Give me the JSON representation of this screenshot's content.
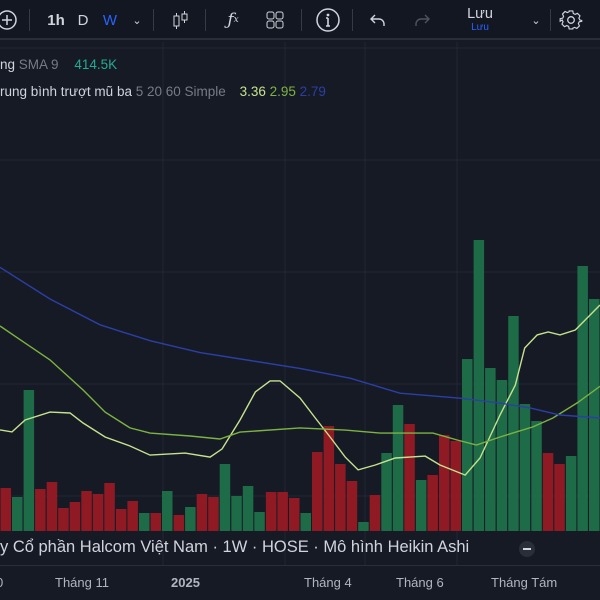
{
  "toolbar": {
    "intervals": [
      "1h",
      "D",
      "W"
    ],
    "active_interval": "W",
    "save_label": "Lưu",
    "save_sublabel": "Lưu"
  },
  "legend": {
    "volume_label": "ng",
    "volume_ma": "SMA 9",
    "volume_value": "414.5K",
    "ema_label": "rung bình trượt mũ ba",
    "ema_params": "5 20 60 Simple",
    "ema_values": [
      "3.36",
      "2.95",
      "2.79"
    ]
  },
  "title": "y Cổ phần Halcom Việt Nam · 1W · HOSE · Mô hình Heikin Ashi",
  "time_axis": [
    "0",
    "Tháng 11",
    "2025",
    "Tháng 4",
    "Tháng 6",
    "Tháng Tám"
  ],
  "colors": {
    "up": "#1e6b48",
    "down": "#8f1a24",
    "ma_fast": "#c7e28f",
    "ma_mid": "#7cb342",
    "ma_slow": "#2b3fa6",
    "accent": "#2962ff"
  },
  "chart_data": {
    "type": "bar",
    "title": "Volume (K) with moving averages",
    "volume_units": "K",
    "volumes": [
      215,
      170,
      705,
      210,
      245,
      115,
      145,
      200,
      185,
      240,
      110,
      150,
      90,
      90,
      200,
      80,
      120,
      185,
      170,
      335,
      175,
      225,
      95,
      195,
      195,
      165,
      90,
      395,
      525,
      335,
      250,
      45,
      180,
      390,
      630,
      535,
      255,
      280,
      480,
      450,
      860,
      1455,
      815,
      755,
      1075,
      635,
      550,
      390,
      335,
      375,
      1325,
      1160
    ],
    "directions": [
      "down",
      "up",
      "up",
      "down",
      "down",
      "down",
      "down",
      "down",
      "down",
      "down",
      "down",
      "down",
      "up",
      "down",
      "up",
      "down",
      "up",
      "down",
      "down",
      "up",
      "up",
      "up",
      "up",
      "down",
      "down",
      "down",
      "up",
      "down",
      "down",
      "down",
      "down",
      "up",
      "down",
      "up",
      "up",
      "down",
      "up",
      "down",
      "down",
      "down",
      "up",
      "up",
      "up",
      "up",
      "up",
      "up",
      "up",
      "down",
      "down",
      "up",
      "up",
      "up"
    ],
    "lines": [
      {
        "name": "MA 5",
        "color": "ma_fast",
        "points": [
          [
            0,
            2.73
          ],
          [
            1.02,
            2.72
          ],
          [
            2.13,
            2.78
          ],
          [
            4.25,
            2.82
          ],
          [
            5.95,
            2.815
          ],
          [
            7.06,
            2.765
          ],
          [
            8.93,
            2.694
          ],
          [
            11.05,
            2.649
          ],
          [
            12.75,
            2.603
          ],
          [
            15.73,
            2.613
          ],
          [
            17.86,
            2.593
          ],
          [
            18.88,
            2.634
          ],
          [
            20.4,
            2.78
          ],
          [
            21.7,
            2.921
          ],
          [
            22.96,
            2.977
          ],
          [
            23.8,
            2.977
          ],
          [
            25.5,
            2.891
          ],
          [
            26.8,
            2.79
          ],
          [
            28.06,
            2.694
          ],
          [
            29.34,
            2.593
          ],
          [
            30.44,
            2.528
          ],
          [
            31.9,
            2.553
          ],
          [
            33.6,
            2.588
          ],
          [
            36.14,
            2.598
          ],
          [
            37.4,
            2.553
          ],
          [
            39.54,
            2.502
          ],
          [
            40.8,
            2.588
          ],
          [
            42.5,
            2.805
          ],
          [
            43.8,
            2.956
          ],
          [
            44.6,
            3.143
          ],
          [
            45.66,
            3.209
          ],
          [
            46.6,
            3.224
          ],
          [
            47.6,
            3.209
          ],
          [
            48.9,
            3.234
          ],
          [
            51,
            3.36
          ]
        ]
      },
      {
        "name": "MA 20",
        "color": "ma_mid",
        "points": [
          [
            0,
            3.254
          ],
          [
            2.13,
            3.168
          ],
          [
            4.25,
            3.083
          ],
          [
            7.06,
            2.931
          ],
          [
            8.93,
            2.82
          ],
          [
            11.05,
            2.74
          ],
          [
            12.75,
            2.714
          ],
          [
            16.16,
            2.699
          ],
          [
            18.7,
            2.684
          ],
          [
            20.4,
            2.719
          ],
          [
            25.5,
            2.74
          ],
          [
            29.34,
            2.729
          ],
          [
            32.3,
            2.714
          ],
          [
            36.8,
            2.714
          ],
          [
            38.86,
            2.679
          ],
          [
            40.5,
            2.654
          ],
          [
            42.5,
            2.694
          ],
          [
            45.3,
            2.745
          ],
          [
            47,
            2.79
          ],
          [
            49.06,
            2.866
          ],
          [
            51,
            2.95
          ]
        ]
      },
      {
        "name": "MA 60",
        "color": "ma_slow",
        "points": [
          [
            0,
            3.55
          ],
          [
            4.25,
            3.39
          ],
          [
            8.5,
            3.26
          ],
          [
            12.75,
            3.18
          ],
          [
            17,
            3.12
          ],
          [
            21.26,
            3.08
          ],
          [
            25.5,
            3.04
          ],
          [
            29.8,
            2.99
          ],
          [
            34,
            2.915
          ],
          [
            39.1,
            2.89
          ],
          [
            42.5,
            2.865
          ],
          [
            45.1,
            2.84
          ],
          [
            47.6,
            2.805
          ],
          [
            51,
            2.79
          ]
        ]
      }
    ]
  }
}
